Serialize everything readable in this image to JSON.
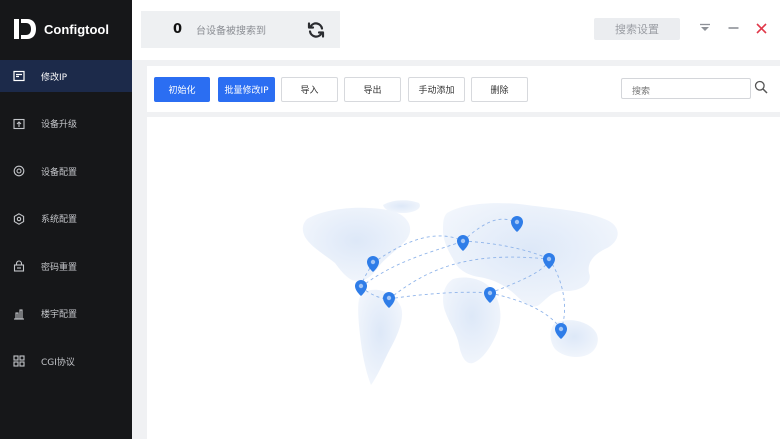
{
  "app": {
    "name": "Configtool"
  },
  "sidebar": {
    "items": [
      {
        "label": "修改IP",
        "icon": "edit-box-icon",
        "active": true
      },
      {
        "label": "设备升级",
        "icon": "upload-icon"
      },
      {
        "label": "设备配置",
        "icon": "target-icon"
      },
      {
        "label": "系统配置",
        "icon": "hexagon-gear-icon"
      },
      {
        "label": "密码重置",
        "icon": "lock-reset-icon"
      },
      {
        "label": "楼宇配置",
        "icon": "building-chart-icon"
      },
      {
        "label": "CGI协议",
        "icon": "grid-protocol-icon"
      }
    ]
  },
  "header": {
    "device_count": "0",
    "device_count_label": "台设备被搜索到",
    "search_settings": "搜索设置"
  },
  "toolbar": {
    "init": "初始化",
    "batch_modify": "批量修改IP",
    "import": "导入",
    "export": "导出",
    "manual_add": "手动添加",
    "delete": "删除",
    "search_placeholder": "搜索"
  },
  "colors": {
    "sidebar_bg": "#161719",
    "active_bg": "#1c2a4a",
    "primary": "#2b6ef2",
    "map_land": "#e8f0fb",
    "pin": "#2f7de8"
  }
}
